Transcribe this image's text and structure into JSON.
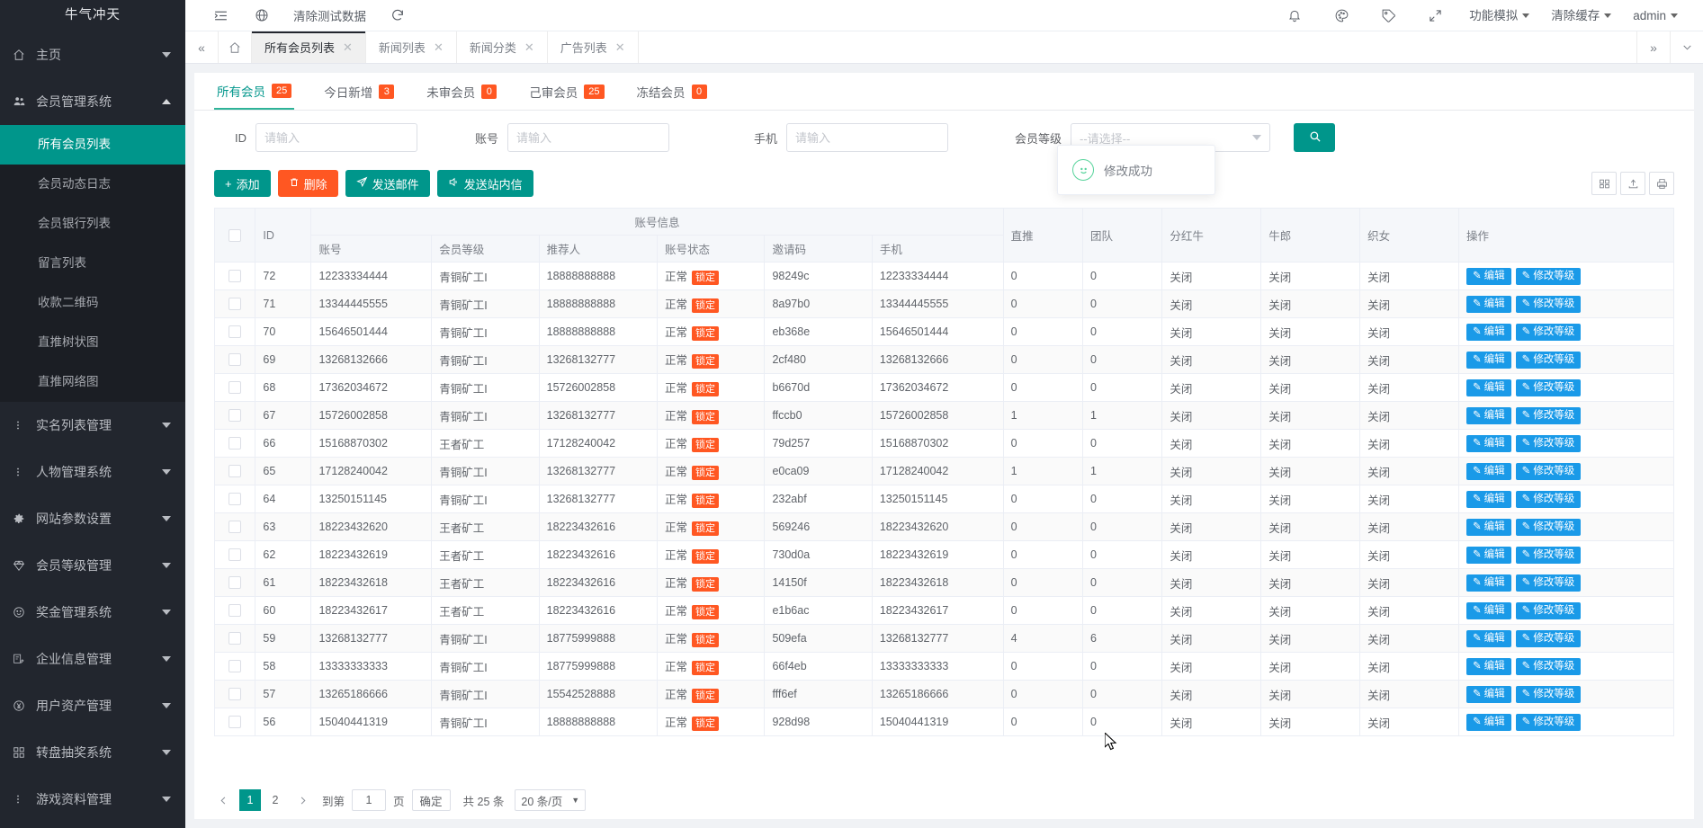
{
  "sidebar": {
    "brand": "牛气冲天",
    "groups": [
      {
        "icon": "home-icon",
        "label": "主页",
        "expanded": false,
        "items": []
      },
      {
        "icon": "users-icon",
        "label": "会员管理系统",
        "expanded": true,
        "items": [
          {
            "label": "所有会员列表",
            "active": true
          },
          {
            "label": "会员动态日志",
            "active": false
          },
          {
            "label": "会员银行列表",
            "active": false
          },
          {
            "label": "留言列表",
            "active": false
          },
          {
            "label": "收款二维码",
            "active": false
          },
          {
            "label": "直推树状图",
            "active": false
          },
          {
            "label": "直推网络图",
            "active": false
          }
        ]
      },
      {
        "icon": "dots-icon",
        "label": "实名列表管理",
        "expanded": false,
        "items": []
      },
      {
        "icon": "dots-icon",
        "label": "人物管理系统",
        "expanded": false,
        "items": []
      },
      {
        "icon": "gear-icon",
        "label": "网站参数设置",
        "expanded": false,
        "items": []
      },
      {
        "icon": "diamond-icon",
        "label": "会员等级管理",
        "expanded": false,
        "items": []
      },
      {
        "icon": "smiley-icon",
        "label": "奖金管理系统",
        "expanded": false,
        "items": []
      },
      {
        "icon": "document-edit-icon",
        "label": "企业信息管理",
        "expanded": false,
        "items": []
      },
      {
        "icon": "yen-icon",
        "label": "用户资产管理",
        "expanded": false,
        "items": []
      },
      {
        "icon": "grid-icon",
        "label": "转盘抽奖系统",
        "expanded": false,
        "items": []
      },
      {
        "icon": "dots-icon",
        "label": "游戏资料管理",
        "expanded": false,
        "items": []
      }
    ]
  },
  "topbar": {
    "collapse_icon": "menu-collapse-icon",
    "globe_icon": "globe-icon",
    "clear_test_data": "清除测试数据",
    "refresh_icon": "refresh-icon",
    "bell_icon": "bell-icon",
    "palette_icon": "palette-icon",
    "tag_icon": "tag-icon",
    "fullscreen_icon": "fullscreen-icon",
    "func_sim": "功能模拟",
    "clear_cache": "清除缓存",
    "user": "admin"
  },
  "tabstrip": {
    "back_icon": "double-chevron-left-icon",
    "home_icon": "home-icon",
    "tabs": [
      {
        "label": "所有会员列表",
        "active": true
      },
      {
        "label": "新闻列表",
        "active": false
      },
      {
        "label": "新闻分类",
        "active": false
      },
      {
        "label": "广告列表",
        "active": false
      }
    ],
    "forward_icon": "double-chevron-right-icon",
    "dropdown_icon": "chevron-down-icon"
  },
  "status_tabs": [
    {
      "label": "所有会员",
      "count": "25",
      "active": true
    },
    {
      "label": "今日新增",
      "count": "3",
      "active": false
    },
    {
      "label": "未审会员",
      "count": "0",
      "active": false
    },
    {
      "label": "己审会员",
      "count": "25",
      "active": false
    },
    {
      "label": "冻结会员",
      "count": "0",
      "active": false
    }
  ],
  "filters": {
    "id": {
      "label": "ID",
      "value": "",
      "placeholder": "请输入"
    },
    "account": {
      "label": "账号",
      "value": "",
      "placeholder": "请输入"
    },
    "phone": {
      "label": "手机",
      "value": "",
      "placeholder": "请输入"
    },
    "level": {
      "label": "会员等级",
      "value": "--请选择--"
    },
    "search_icon": "search-icon"
  },
  "actions": {
    "add": "添加",
    "delete": "删除",
    "send_mail": "发送邮件",
    "send_message": "发送站内信",
    "tool_icons": [
      "columns-icon",
      "export-icon",
      "print-icon"
    ]
  },
  "toast": {
    "icon": "smiley-icon",
    "text": "修改成功"
  },
  "table": {
    "group_header": "账号信息",
    "columns": [
      "ID",
      "账号",
      "会员等级",
      "推荐人",
      "账号状态",
      "邀请码",
      "手机",
      "直推",
      "团队",
      "分红牛",
      "牛郎",
      "织女",
      "操作"
    ],
    "lock_tag": "锁定",
    "edit_label": "编辑",
    "edit_level_label": "修改等级",
    "edit_icon": "pencil-icon",
    "rows": [
      {
        "id": "72",
        "account": "12233334444",
        "level": "青铜矿工I",
        "referrer": "18888888888",
        "status": "正常",
        "invite": "98249c",
        "phone": "12233334444",
        "direct": "0",
        "team": "0",
        "dividend": "关闭",
        "niulang": "关闭",
        "zhinv": "关闭"
      },
      {
        "id": "71",
        "account": "13344445555",
        "level": "青铜矿工I",
        "referrer": "18888888888",
        "status": "正常",
        "invite": "8a97b0",
        "phone": "13344445555",
        "direct": "0",
        "team": "0",
        "dividend": "关闭",
        "niulang": "关闭",
        "zhinv": "关闭"
      },
      {
        "id": "70",
        "account": "15646501444",
        "level": "青铜矿工I",
        "referrer": "18888888888",
        "status": "正常",
        "invite": "eb368e",
        "phone": "15646501444",
        "direct": "0",
        "team": "0",
        "dividend": "关闭",
        "niulang": "关闭",
        "zhinv": "关闭"
      },
      {
        "id": "69",
        "account": "13268132666",
        "level": "青铜矿工I",
        "referrer": "13268132777",
        "status": "正常",
        "invite": "2cf480",
        "phone": "13268132666",
        "direct": "0",
        "team": "0",
        "dividend": "关闭",
        "niulang": "关闭",
        "zhinv": "关闭"
      },
      {
        "id": "68",
        "account": "17362034672",
        "level": "青铜矿工I",
        "referrer": "15726002858",
        "status": "正常",
        "invite": "b6670d",
        "phone": "17362034672",
        "direct": "0",
        "team": "0",
        "dividend": "关闭",
        "niulang": "关闭",
        "zhinv": "关闭"
      },
      {
        "id": "67",
        "account": "15726002858",
        "level": "青铜矿工I",
        "referrer": "13268132777",
        "status": "正常",
        "invite": "ffccb0",
        "phone": "15726002858",
        "direct": "1",
        "team": "1",
        "dividend": "关闭",
        "niulang": "关闭",
        "zhinv": "关闭"
      },
      {
        "id": "66",
        "account": "15168870302",
        "level": "王者矿工",
        "referrer": "17128240042",
        "status": "正常",
        "invite": "79d257",
        "phone": "15168870302",
        "direct": "0",
        "team": "0",
        "dividend": "关闭",
        "niulang": "关闭",
        "zhinv": "关闭"
      },
      {
        "id": "65",
        "account": "17128240042",
        "level": "青铜矿工I",
        "referrer": "13268132777",
        "status": "正常",
        "invite": "e0ca09",
        "phone": "17128240042",
        "direct": "1",
        "team": "1",
        "dividend": "关闭",
        "niulang": "关闭",
        "zhinv": "关闭"
      },
      {
        "id": "64",
        "account": "13250151145",
        "level": "青铜矿工I",
        "referrer": "13268132777",
        "status": "正常",
        "invite": "232abf",
        "phone": "13250151145",
        "direct": "0",
        "team": "0",
        "dividend": "关闭",
        "niulang": "关闭",
        "zhinv": "关闭"
      },
      {
        "id": "63",
        "account": "18223432620",
        "level": "王者矿工",
        "referrer": "18223432616",
        "status": "正常",
        "invite": "569246",
        "phone": "18223432620",
        "direct": "0",
        "team": "0",
        "dividend": "关闭",
        "niulang": "关闭",
        "zhinv": "关闭"
      },
      {
        "id": "62",
        "account": "18223432619",
        "level": "王者矿工",
        "referrer": "18223432616",
        "status": "正常",
        "invite": "730d0a",
        "phone": "18223432619",
        "direct": "0",
        "team": "0",
        "dividend": "关闭",
        "niulang": "关闭",
        "zhinv": "关闭"
      },
      {
        "id": "61",
        "account": "18223432618",
        "level": "王者矿工",
        "referrer": "18223432616",
        "status": "正常",
        "invite": "14150f",
        "phone": "18223432618",
        "direct": "0",
        "team": "0",
        "dividend": "关闭",
        "niulang": "关闭",
        "zhinv": "关闭"
      },
      {
        "id": "60",
        "account": "18223432617",
        "level": "王者矿工",
        "referrer": "18223432616",
        "status": "正常",
        "invite": "e1b6ac",
        "phone": "18223432617",
        "direct": "0",
        "team": "0",
        "dividend": "关闭",
        "niulang": "关闭",
        "zhinv": "关闭"
      },
      {
        "id": "59",
        "account": "13268132777",
        "level": "青铜矿工I",
        "referrer": "18775999888",
        "status": "正常",
        "invite": "509efa",
        "phone": "13268132777",
        "direct": "4",
        "team": "6",
        "dividend": "关闭",
        "niulang": "关闭",
        "zhinv": "关闭"
      },
      {
        "id": "58",
        "account": "13333333333",
        "level": "青铜矿工I",
        "referrer": "18775999888",
        "status": "正常",
        "invite": "66f4eb",
        "phone": "13333333333",
        "direct": "0",
        "team": "0",
        "dividend": "关闭",
        "niulang": "关闭",
        "zhinv": "关闭"
      },
      {
        "id": "57",
        "account": "13265186666",
        "level": "青铜矿工I",
        "referrer": "15542528888",
        "status": "正常",
        "invite": "fff6ef",
        "phone": "13265186666",
        "direct": "0",
        "team": "0",
        "dividend": "关闭",
        "niulang": "关闭",
        "zhinv": "关闭"
      },
      {
        "id": "56",
        "account": "15040441319",
        "level": "青铜矿工I",
        "referrer": "18888888888",
        "status": "正常",
        "invite": "928d98",
        "phone": "15040441319",
        "direct": "0",
        "team": "0",
        "dividend": "关闭",
        "niulang": "关闭",
        "zhinv": "关闭"
      }
    ]
  },
  "pagination": {
    "prev_icon": "chevron-left-icon",
    "next_icon": "chevron-right-icon",
    "pages": [
      "1",
      "2"
    ],
    "current_page": "1",
    "goto_label": "到第",
    "goto_value": "1",
    "page_unit": "页",
    "confirm": "确定",
    "total": "共 25 条",
    "page_size": "20 条/页"
  },
  "colors": {
    "accent": "#00968b",
    "danger": "#ff5722",
    "link": "#1a9ae8",
    "sidebar_bg": "#22262e"
  }
}
